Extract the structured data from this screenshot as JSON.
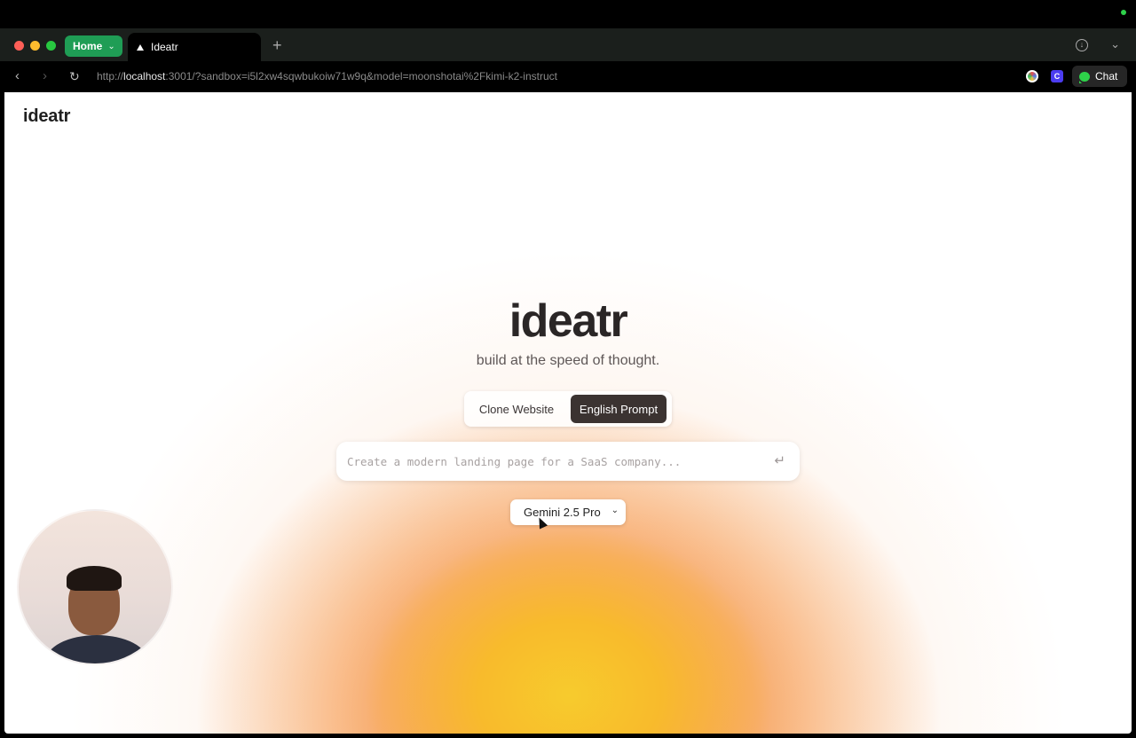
{
  "browser": {
    "home_label": "Home",
    "tab_title": "Ideatr",
    "new_tab_symbol": "+",
    "url_scheme": "http://",
    "url_host": "localhost",
    "url_rest": ":3001/?sandbox=i5l2xw4sqwbukoiw71w9q&model=moonshotai%2Fkimi-k2-instruct",
    "chat_label": "Chat",
    "icons": [
      "back-icon",
      "forward-icon",
      "reload-icon",
      "download-icon",
      "chevron-down-icon",
      "extension-icon",
      "chat-icon"
    ]
  },
  "page": {
    "brand": "ideatr",
    "hero_title": "ideatr",
    "hero_subtitle": "build at the speed of thought.",
    "mode_toggle": {
      "options": [
        "Clone Website",
        "English Prompt"
      ],
      "selected": "English Prompt"
    },
    "prompt": {
      "placeholder": "Create a modern landing page for a SaaS company...",
      "value": "",
      "submit_symbol": "↵"
    },
    "model_select": {
      "selected": "Gemini 2.5 Pro"
    }
  },
  "colors": {
    "accent_green": "#1f9d55",
    "toggle_active": "#3b3331",
    "glow_yellow": "#f7cb2d",
    "glow_orange": "#f5923c"
  }
}
